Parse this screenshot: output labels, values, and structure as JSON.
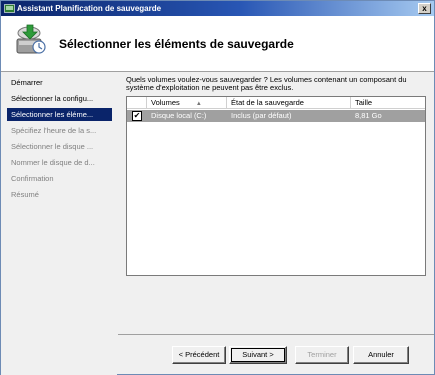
{
  "window": {
    "title": "Assistant Planification de sauvegarde",
    "close_label": "x"
  },
  "header": {
    "title": "Sélectionner les éléments de sauvegarde",
    "icon": "backup-wizard-icon"
  },
  "sidebar": {
    "items": [
      {
        "label": "Démarrer",
        "state": "done"
      },
      {
        "label": "Sélectionner la configu...",
        "state": "done"
      },
      {
        "label": "Sélectionner les éléme...",
        "state": "active"
      },
      {
        "label": "Spécifiez l'heure de la s...",
        "state": "pending"
      },
      {
        "label": "Sélectionner le disque ...",
        "state": "pending"
      },
      {
        "label": "Nommer le disque de d...",
        "state": "pending"
      },
      {
        "label": "Confirmation",
        "state": "pending"
      },
      {
        "label": "Résumé",
        "state": "pending"
      }
    ]
  },
  "main": {
    "question": "Quels volumes voulez-vous sauvegarder ? Les volumes contenant un composant du système d'exploitation ne peuvent pas être exclus.",
    "table": {
      "columns": [
        "Volumes",
        "État de la sauvegarde",
        "Taille"
      ],
      "sort_indicator": "▲",
      "rows": [
        {
          "checked": true,
          "check_glyph": "✔",
          "volume": "Disque local (C:)",
          "state": "Inclus (par défaut)",
          "size": "8,81 Go"
        }
      ]
    }
  },
  "buttons": {
    "previous": "< Précédent",
    "next": "Suivant >",
    "finish": "Terminer",
    "cancel": "Annuler"
  }
}
